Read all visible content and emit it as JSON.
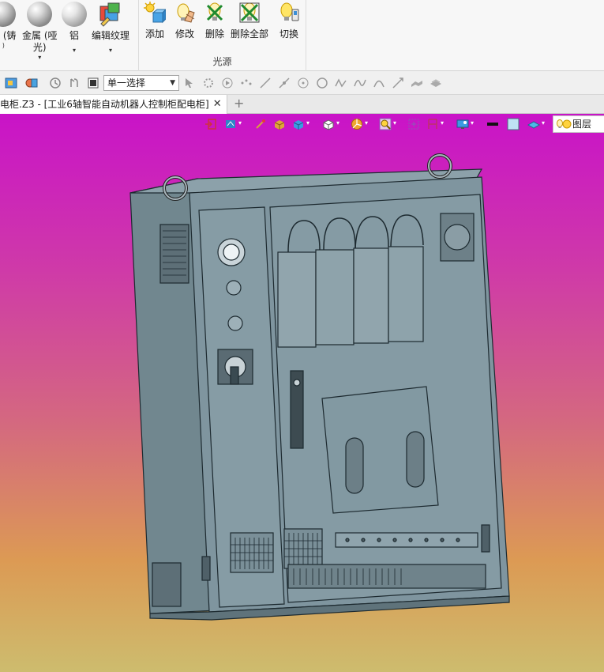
{
  "ribbon": {
    "material_group": {
      "buttons": [
        {
          "label_line1": "属 (铸",
          "label_line2": ")",
          "icon": "cast-metal-sphere-icon"
        },
        {
          "label_line1": "金属 (哑",
          "label_line2": "光)",
          "icon": "matte-metal-sphere-icon"
        },
        {
          "label_line1": "铝",
          "label_line2": "",
          "icon": "aluminum-sphere-icon"
        },
        {
          "label_line1": "编辑纹理",
          "label_line2": "",
          "icon": "edit-texture-icon"
        }
      ]
    },
    "light_group": {
      "title": "光源",
      "buttons": [
        {
          "label": "添加",
          "icon": "add-light-icon"
        },
        {
          "label": "修改",
          "icon": "modify-light-icon"
        },
        {
          "label": "删除",
          "icon": "delete-light-icon"
        },
        {
          "label": "删除全部",
          "icon": "delete-all-lights-icon"
        },
        {
          "label": "切换",
          "icon": "toggle-light-icon"
        }
      ]
    }
  },
  "toolbar": {
    "filter_select": "单一选择"
  },
  "tabs": [
    {
      "label": "电柜.Z3 - [工业6轴智能自动机器人控制柜配电柜]",
      "active": true
    }
  ],
  "tab_add_label": "+",
  "tab_close_label": "✕",
  "viewport": {
    "layer_button": "图层",
    "colors": {
      "gradient_top": "#c913c8",
      "gradient_bottom": "#cdbc6e",
      "model_fill": "#7c929c",
      "model_line": "#1d2a30"
    }
  }
}
